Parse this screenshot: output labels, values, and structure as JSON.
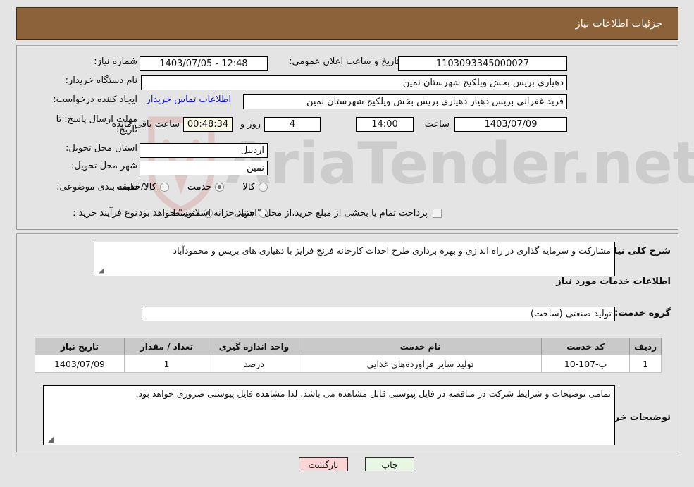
{
  "header": {
    "title": "جزئیات اطلاعات نیاز",
    "bg": "#8b6239"
  },
  "fields": {
    "need_number_label": "شماره نیاز:",
    "need_number_value": "1103093345000027",
    "announce_label": "تاریخ و ساعت اعلان عمومی:",
    "announce_value": "12:48 - 1403/07/05",
    "buyer_org_label": "نام دستگاه خریدار:",
    "buyer_org_value": "دهیاری بریس بخش ویلکیج شهرستان نمین",
    "requester_label": "ایجاد کننده درخواست:",
    "requester_value": "فرید غفرانی بریس دهیار دهیاری بریس بخش ویلکیج شهرستان نمین",
    "contact_link": "اطلاعات تماس خریدار",
    "deadline_label": "مهلت ارسال پاسخ: تا تاریخ:",
    "deadline_date": "1403/07/09",
    "deadline_hour_label": "ساعت",
    "deadline_hour": "14:00",
    "days_remaining": "4",
    "days_sep_label": "روز و",
    "countdown": "00:48:34",
    "countdown_label": "ساعت باقی مانده",
    "province_label": "استان محل تحویل:",
    "province_value": "اردبیل",
    "city_label": "شهر محل تحویل:",
    "city_value": "نمین",
    "category_label": "طبقه بندی موضوعی:",
    "category_options": [
      {
        "label": "کالا",
        "selected": false
      },
      {
        "label": "خدمت",
        "selected": true
      },
      {
        "label": "کالا/خدمت",
        "selected": false
      }
    ],
    "process_label": "نوع فرآیند خرید :",
    "process_options": [
      {
        "label": "جزیی",
        "selected": false
      },
      {
        "label": "متوسط",
        "selected": true
      }
    ],
    "treasury_checkbox_checked": false,
    "treasury_text": "پرداخت تمام یا بخشی از مبلغ خرید،از محل \"اسناد خزانه اسلامی\" خواهد بود."
  },
  "description": {
    "label": "شرح کلی نیاز:",
    "value": "مشارکت و سرمایه گذاری در راه اندازی و بهره برداری طرح احداث کارخانه فرنج فرایز با دهیاری های بریس و محمودآباد"
  },
  "services": {
    "section_title": "اطلاعات خدمات مورد نیاز",
    "group_label": "گروه خدمت:",
    "group_value": "تولید صنعتی (ساخت)",
    "columns": [
      "ردیف",
      "کد خدمت",
      "نام خدمت",
      "واحد اندازه گیری",
      "تعداد / مقدار",
      "تاریخ نیاز"
    ],
    "rows": [
      {
        "radif": "1",
        "code": "ب-107-10",
        "name": "تولید سایر فراورده‌های غذایی",
        "unit": "درصد",
        "qty": "1",
        "date": "1403/07/09"
      }
    ]
  },
  "buyer_notes": {
    "label": "توضیحات خریدار:",
    "value": "تمامی توضیحات و شرایط شرکت در مناقصه در فایل پیوستی قابل مشاهده می باشد، لذا مشاهده فایل پیوستی ضروری خواهد بود."
  },
  "footer": {
    "print_label": "چاپ",
    "back_label": "بازگشت"
  },
  "watermark": {
    "text": "AriaTender.net"
  }
}
